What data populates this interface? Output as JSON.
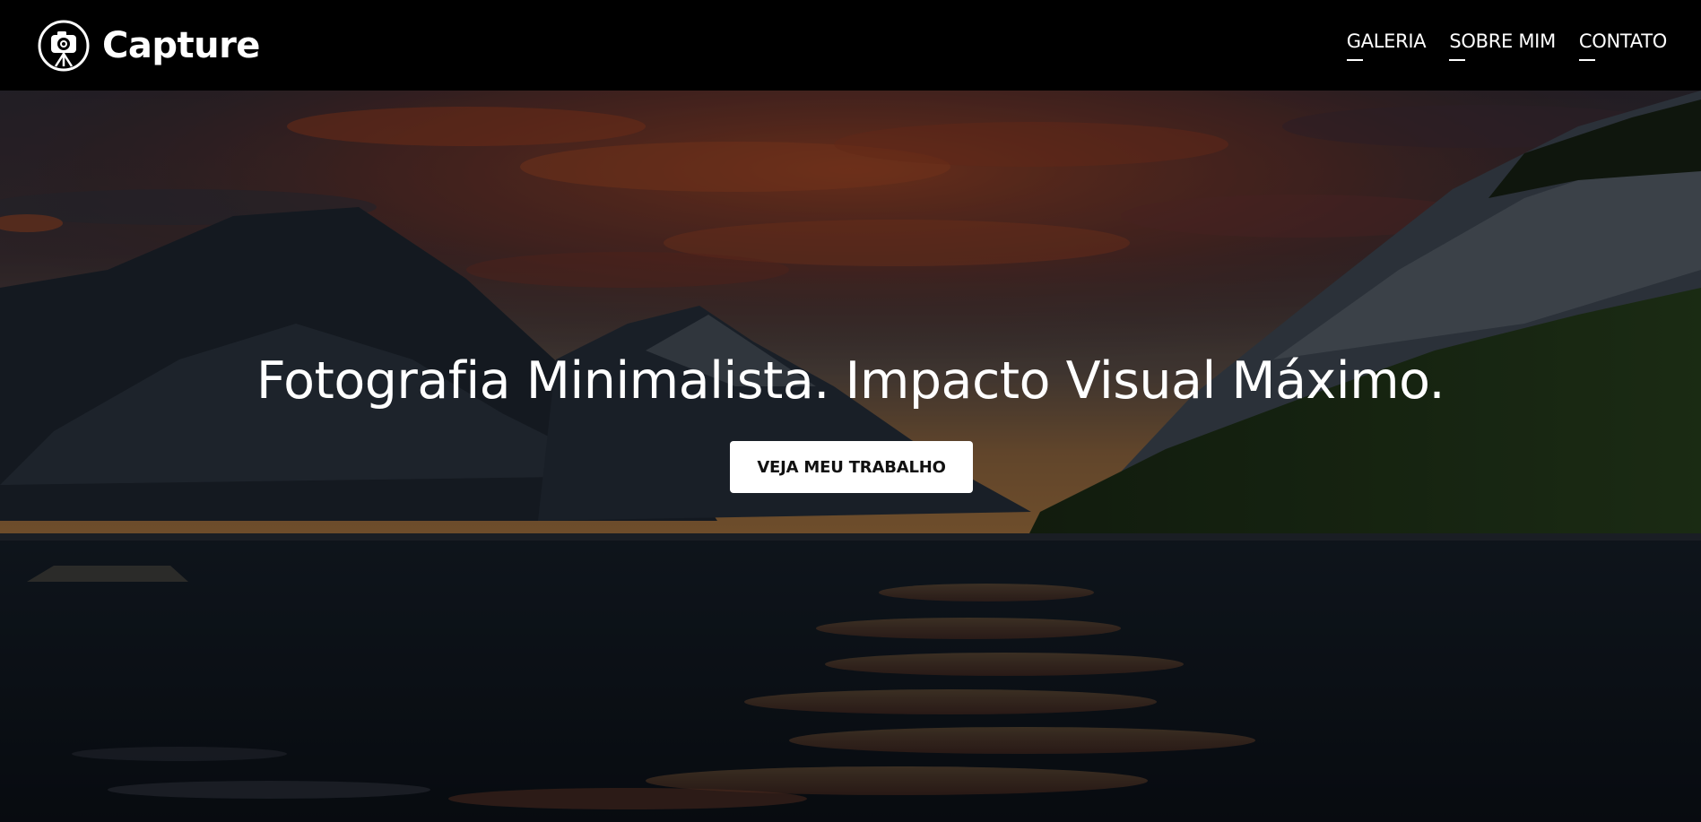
{
  "header": {
    "brand_name": "Capture",
    "logo_icon": "camera-on-tripod-icon",
    "nav": [
      {
        "label": "GALERIA"
      },
      {
        "label": "SOBRE MIM"
      },
      {
        "label": "CONTATO"
      }
    ]
  },
  "hero": {
    "heading": "Fotografia Minimalista. Impacto Visual Máximo.",
    "cta_label": "VEJA MEU TRABALHO",
    "background_description_icon": "lake-sunset-landscape-image"
  },
  "colors": {
    "navbar_bg": "#000000",
    "text": "#ffffff",
    "cta_bg": "#ffffff",
    "cta_text": "#111111"
  }
}
